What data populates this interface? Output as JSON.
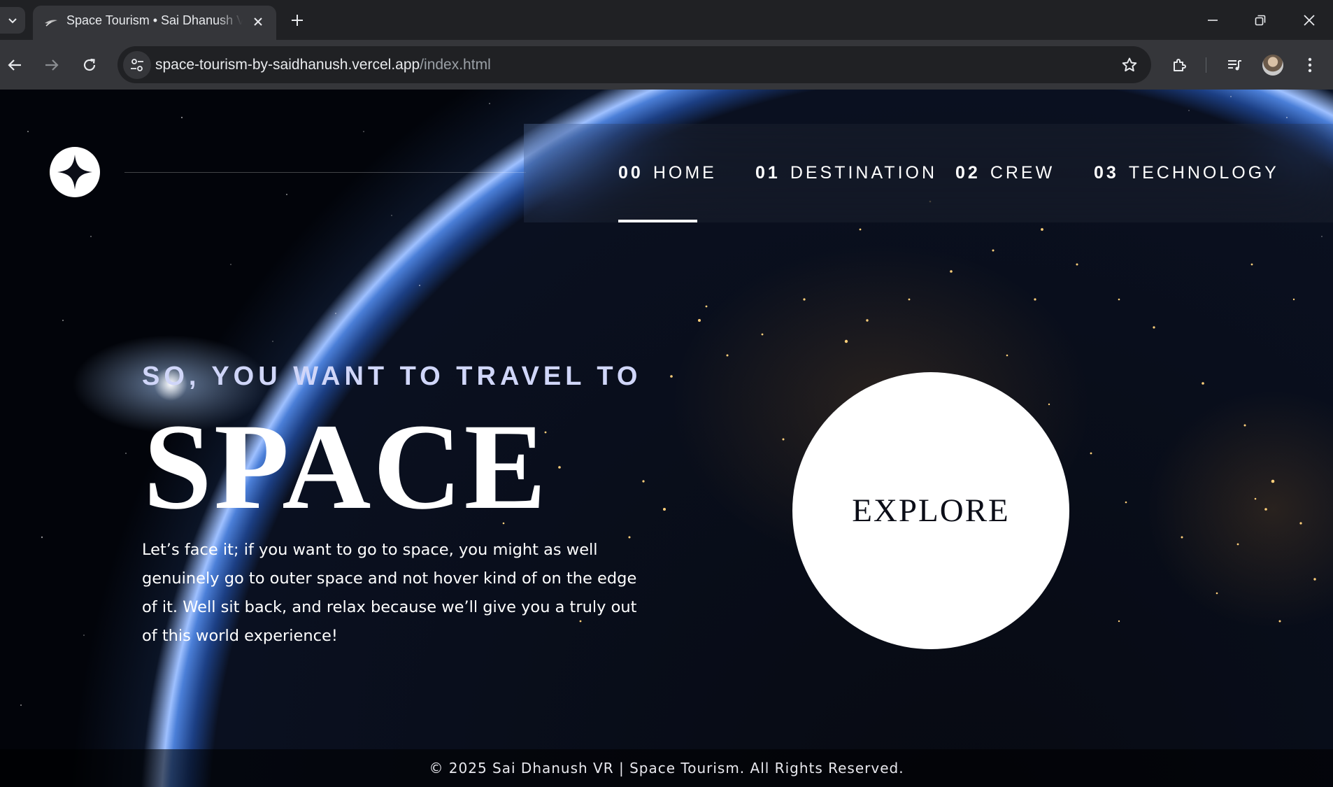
{
  "browser": {
    "tab_title": "Space Tourism • Sai Dhanush VR",
    "url_host": "space-tourism-by-saidhanush.vercel.app",
    "url_path": "/index.html"
  },
  "nav": {
    "items": [
      {
        "num": "00",
        "label": "HOME",
        "active": true
      },
      {
        "num": "01",
        "label": "DESTINATION"
      },
      {
        "num": "02",
        "label": "CREW"
      },
      {
        "num": "03",
        "label": "TECHNOLOGY"
      }
    ]
  },
  "hero": {
    "eyebrow": "SO, YOU WANT TO TRAVEL TO",
    "title": "SPACE",
    "body": "Let’s face it; if you want to go to space, you might as well genuinely go to outer space and not hover kind of on the edge of it. Well sit back, and relax because we’ll give you a truly out of this world experience!",
    "cta": "EXPLORE"
  },
  "footer": {
    "text": "© 2025 Sai Dhanush VR | Space Tourism. All Rights Reserved."
  },
  "colors": {
    "page_bg": "#0b0d17",
    "eyebrow": "#d0d6f9",
    "chrome_dark": "#202124",
    "chrome_mid": "#35363a"
  }
}
